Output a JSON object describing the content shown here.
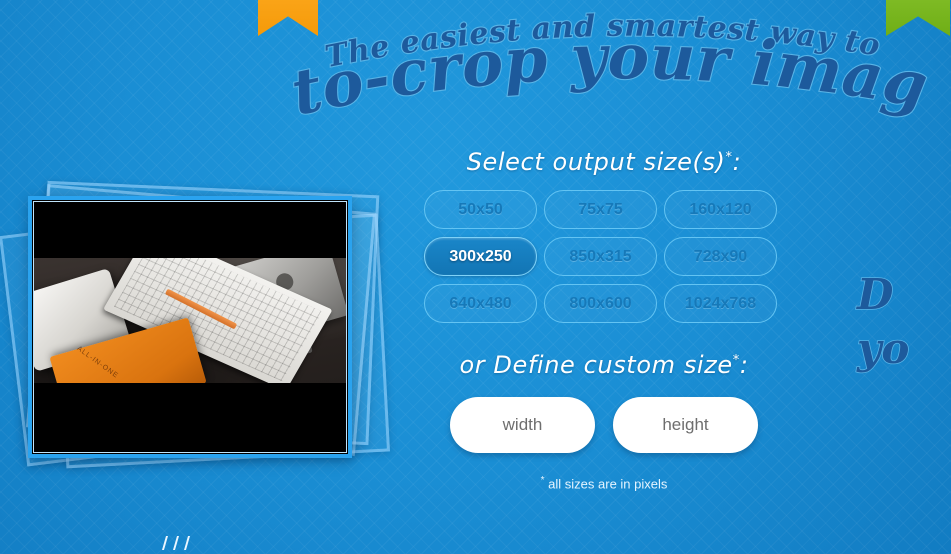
{
  "page": {
    "background_color": "#1a8ed4",
    "accent_dark": "#1d5a9c",
    "accent_light": "#63c4f3"
  },
  "ribbons": [
    {
      "name": "orange-ribbon",
      "color": "#f59a09"
    },
    {
      "name": "green-ribbon",
      "color": "#7fbb1e"
    }
  ],
  "headline": {
    "line1": "The easiest and smartest way to",
    "line2": "auto-crop your images"
  },
  "teaser": {
    "line1": "D",
    "line2": "yo"
  },
  "preview": {
    "alt": "desk photo with iMac keyboard and orange notebook",
    "notebook_text": "ALL-IN-ONE"
  },
  "panel": {
    "sizes_label": "Select output size(s)",
    "sizes_label_mark": "*",
    "sizes_label_colon": ":",
    "sizes": [
      {
        "label": "50x50",
        "selected": false
      },
      {
        "label": "75x75",
        "selected": false
      },
      {
        "label": "160x120",
        "selected": false
      },
      {
        "label": "300x250",
        "selected": true
      },
      {
        "label": "850x315",
        "selected": false
      },
      {
        "label": "728x90",
        "selected": false
      },
      {
        "label": "640x480",
        "selected": false
      },
      {
        "label": "800x600",
        "selected": false
      },
      {
        "label": "1024x768",
        "selected": false
      }
    ],
    "custom_label": "or Define custom size",
    "custom_label_mark": "*",
    "custom_label_colon": ":",
    "width_placeholder": "width",
    "width_value": "",
    "height_placeholder": "height",
    "height_value": "",
    "footnote_mark": "*",
    "footnote": "all sizes are in pixels"
  }
}
